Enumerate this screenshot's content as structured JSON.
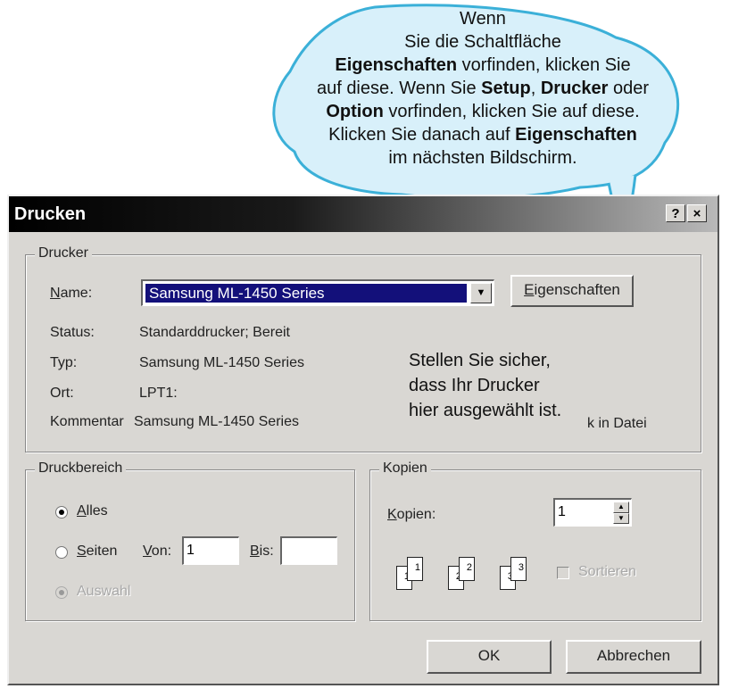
{
  "callout_top": {
    "line1": "Wenn",
    "line2": "Sie die Schaltfläche",
    "line3_bold": "Eigenschaften",
    "line3_rest": " vorfinden, klicken Sie",
    "line4_pre": "auf diese. Wenn Sie ",
    "line4_bold1": "Setup",
    "line4_mid": ", ",
    "line4_bold2": "Drucker",
    "line4_post": " oder",
    "line5_bold": "Option",
    "line5_rest": " vorfinden, klicken Sie auf diese.",
    "line6_pre": "Klicken Sie danach auf ",
    "line6_bold": "Eigenschaften",
    "line7": "im nächsten Bildschirm."
  },
  "callout_mid": {
    "line1": "Stellen Sie sicher,",
    "line2": "dass Ihr Drucker",
    "line3": "hier ausgewählt ist."
  },
  "dialog": {
    "title": "Drucken",
    "help_button": "?",
    "close_button": "×",
    "printer_group": {
      "legend": "Drucker",
      "name_label_u": "N",
      "name_label_rest": "ame:",
      "name_value": "Samsung ML-1450 Series",
      "properties_button_u": "E",
      "properties_button_rest": "igenschaften",
      "status_label": "Status:",
      "status_value": "Standarddrucker; Bereit",
      "type_label": "Typ:",
      "type_value": "Samsung ML-1450 Series",
      "location_label": "Ort:",
      "location_value": "LPT1:",
      "comment_label": "Kommentar",
      "comment_value": "Samsung ML-1450 Series",
      "print_to_file_partial": "k in Datei"
    },
    "range_group": {
      "legend": "Druckbereich",
      "all_u": "A",
      "all_rest": "lles",
      "pages_u": "S",
      "pages_rest": "eiten",
      "from_u": "V",
      "from_rest": "on:",
      "from_value": "1",
      "to_u": "B",
      "to_rest": "is:",
      "to_value": "",
      "selection_label": "Auswahl"
    },
    "copies_group": {
      "legend": "Kopien",
      "copies_u": "K",
      "copies_rest": "opien:",
      "copies_value": "1",
      "collate_label": "Sortieren",
      "page_sets": [
        [
          "1",
          "1"
        ],
        [
          "2",
          "2"
        ],
        [
          "3",
          "3"
        ]
      ]
    },
    "ok_button": "OK",
    "cancel_button": "Abbrechen"
  }
}
